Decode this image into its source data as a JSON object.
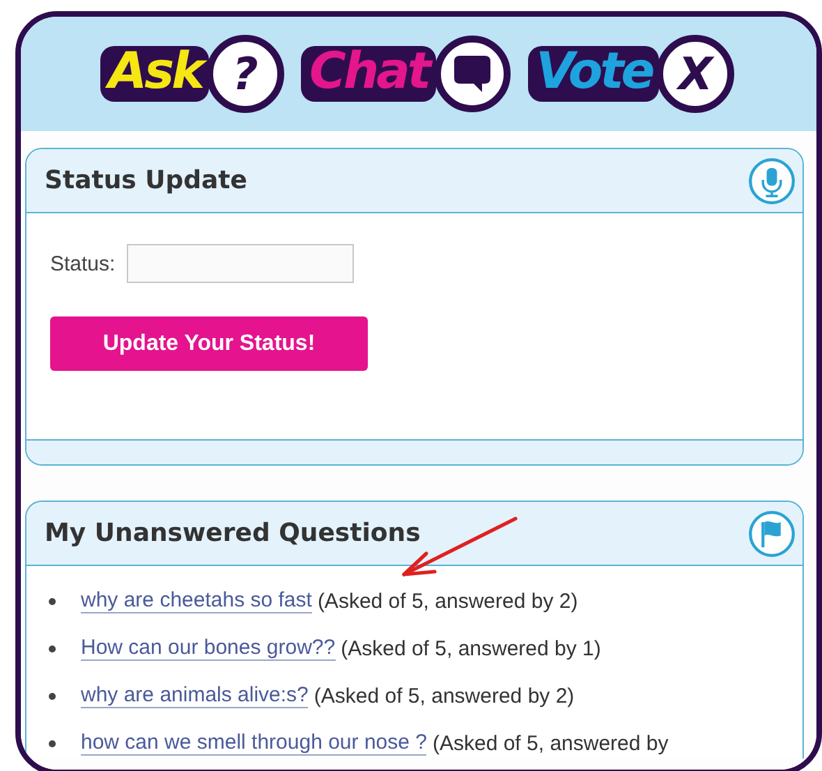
{
  "header": {
    "logos": [
      {
        "word": "Ask",
        "kind": "question",
        "symbol": "?"
      },
      {
        "word": "Chat",
        "kind": "bubble"
      },
      {
        "word": "Vote",
        "kind": "letter",
        "symbol": "X"
      }
    ]
  },
  "status_panel": {
    "title": "Status Update",
    "field_label": "Status:",
    "button": "Update Your Status!"
  },
  "questions_panel": {
    "title": "My Unanswered Questions",
    "questions": [
      {
        "link": "why are cheetahs so fast",
        "detail": "(Asked of 5, answered by 2)"
      },
      {
        "link": "How can our bones grow??",
        "detail": "(Asked of 5, answered by 1)"
      },
      {
        "link": "why are animals alive:s?",
        "detail": "(Asked of 5, answered by 2)"
      },
      {
        "link": "how can we smell through our nose ?",
        "detail": "(Asked of 5, answered by"
      }
    ]
  }
}
